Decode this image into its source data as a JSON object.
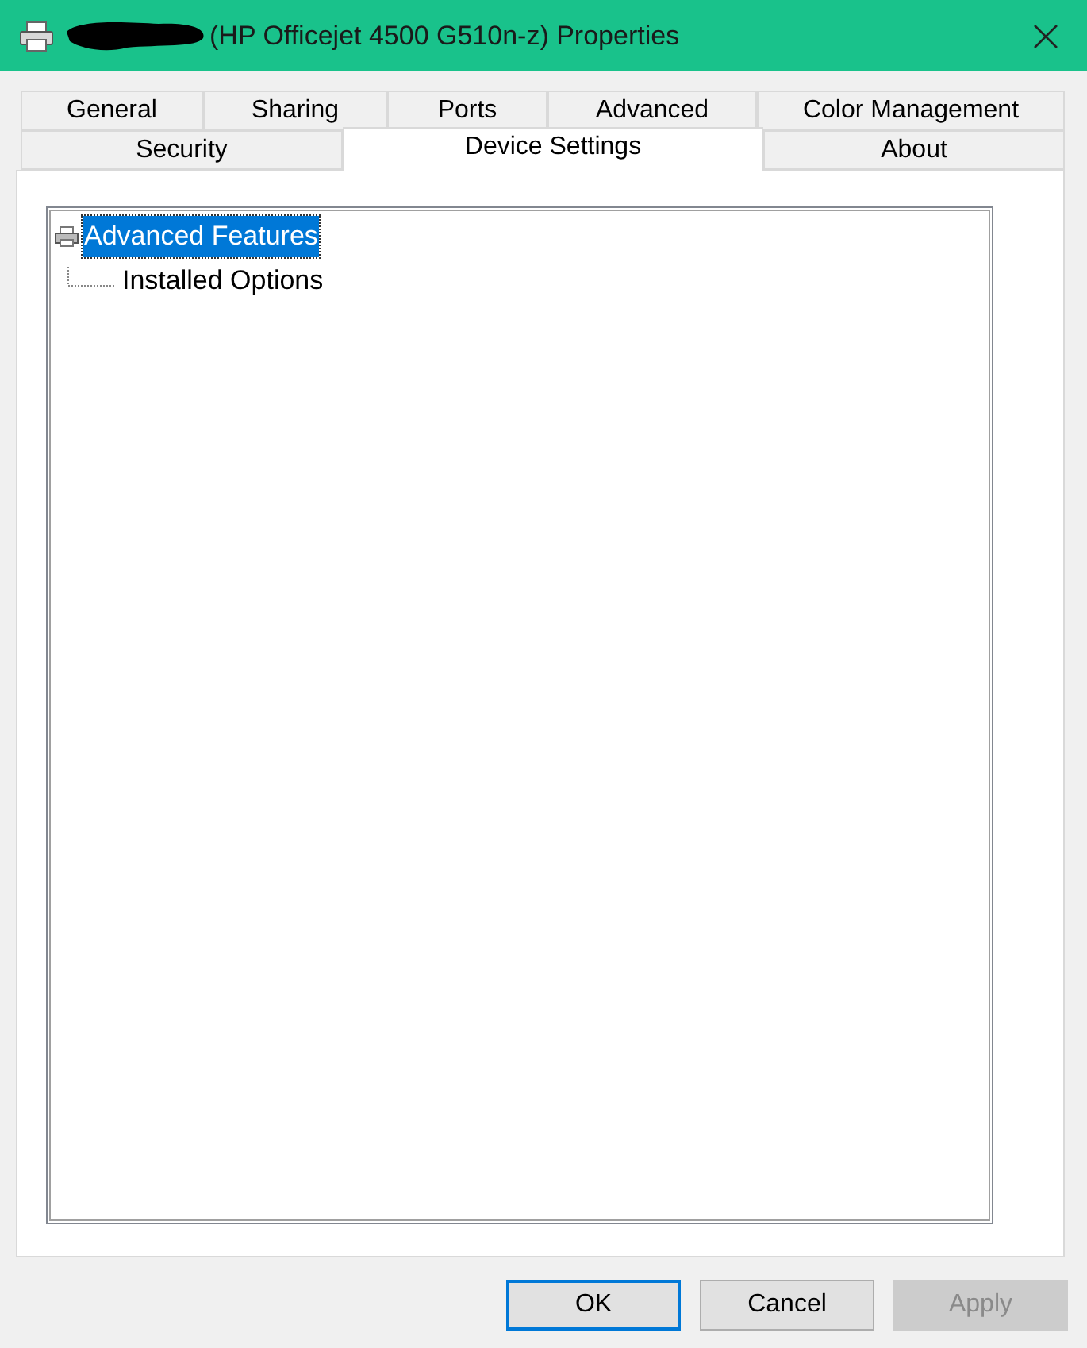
{
  "window": {
    "title": "(HP Officejet 4500 G510n-z) Properties"
  },
  "tab_rows": [
    [
      {
        "label": "General",
        "selected": false
      },
      {
        "label": "Sharing",
        "selected": false
      },
      {
        "label": "Ports",
        "selected": false
      },
      {
        "label": "Advanced",
        "selected": false
      },
      {
        "label": "Color Management",
        "selected": false
      }
    ],
    [
      {
        "label": "Security",
        "selected": false
      },
      {
        "label": "Device Settings",
        "selected": true
      },
      {
        "label": "About",
        "selected": false
      }
    ]
  ],
  "tree": [
    {
      "label": "Advanced Features",
      "selected": true,
      "children": [
        {
          "label": "Installed Options",
          "selected": false
        }
      ]
    }
  ],
  "buttons": [
    {
      "label": "OK",
      "default": true,
      "disabled": false
    },
    {
      "label": "Cancel",
      "default": false,
      "disabled": false
    },
    {
      "label": "Apply",
      "default": false,
      "disabled": true
    }
  ]
}
